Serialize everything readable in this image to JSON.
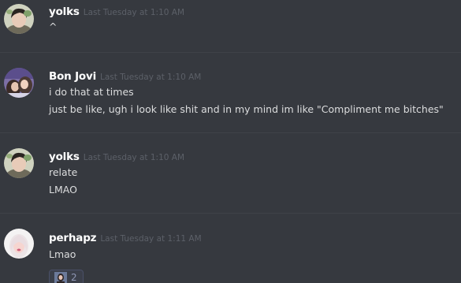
{
  "messages": [
    {
      "username": "yolks",
      "timestamp": "Last Tuesday at 1:10 AM",
      "avatar": "yolks-avatar",
      "lines": [
        "^"
      ]
    },
    {
      "username": "Bon Jovi",
      "timestamp": "Last Tuesday at 1:10 AM",
      "avatar": "bon-jovi-avatar",
      "lines": [
        "i do that at times",
        "just be like, ugh i look like shit and in my mind im like \"Compliment me bitches\""
      ]
    },
    {
      "username": "yolks",
      "timestamp": "Last Tuesday at 1:10 AM",
      "avatar": "yolks-avatar",
      "lines": [
        "relate",
        "LMAO"
      ]
    },
    {
      "username": "perhapz",
      "timestamp": "Last Tuesday at 1:11 AM",
      "avatar": "perhapz-avatar",
      "lines": [
        "Lmao"
      ],
      "reaction": {
        "emoji": "person-emoji",
        "count": "2"
      }
    }
  ],
  "colors": {
    "background": "#36393f",
    "username": "#ffffff",
    "timestamp": "#5c6068",
    "message_text": "#dcddde",
    "divider": "#3f4248",
    "reaction_bg": "#3b3f4a",
    "reaction_border": "#4a5068",
    "reaction_count": "#8f97b5"
  }
}
